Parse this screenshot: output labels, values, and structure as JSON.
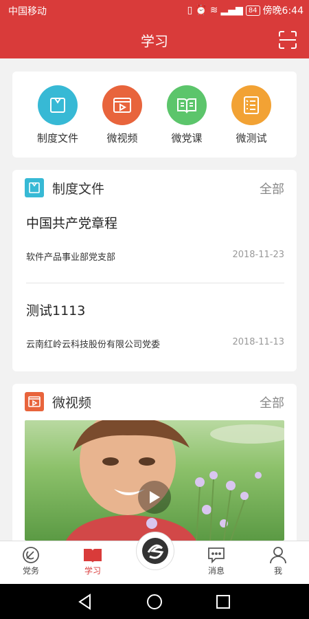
{
  "status": {
    "carrier": "中国移动",
    "battery": "84",
    "time": "傍晚6:44"
  },
  "header": {
    "title": "学习"
  },
  "quick": [
    {
      "label": "制度文件",
      "color": "#37b9d5",
      "icon": "document-bag-icon"
    },
    {
      "label": "微视频",
      "color": "#e8643c",
      "icon": "video-player-icon"
    },
    {
      "label": "微党课",
      "color": "#5cc56b",
      "icon": "open-book-icon"
    },
    {
      "label": "微测试",
      "color": "#f2a234",
      "icon": "test-sheet-icon"
    }
  ],
  "docs_section": {
    "title": "制度文件",
    "all": "全部",
    "items": [
      {
        "title": "中国共产党章程",
        "org": "软件产品事业部党支部",
        "date": "2018-11-23"
      },
      {
        "title": "测试1113",
        "org": "云南红岭云科技股份有限公司党委",
        "date": "2018-11-13"
      }
    ]
  },
  "video_section": {
    "title": "微视频",
    "all": "全部"
  },
  "tabbar": [
    {
      "label": "党务",
      "icon": "party-emblem-icon"
    },
    {
      "label": "学习",
      "icon": "book-icon",
      "active": true
    },
    {
      "label": "",
      "icon": "app-logo-icon"
    },
    {
      "label": "消息",
      "icon": "message-bubble-icon"
    },
    {
      "label": "我",
      "icon": "person-icon"
    }
  ]
}
